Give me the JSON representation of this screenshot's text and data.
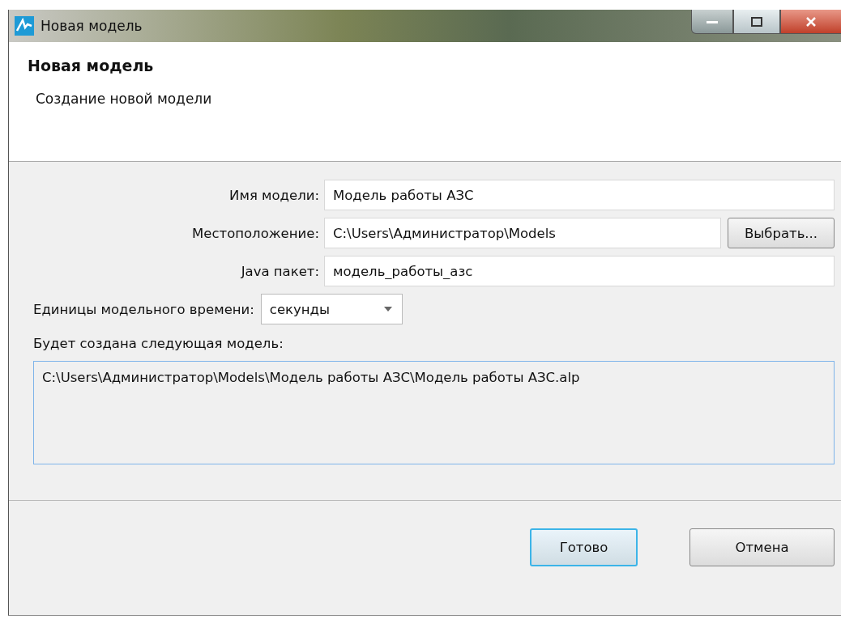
{
  "window": {
    "title": "Новая модель"
  },
  "header": {
    "title": "Новая модель",
    "subtitle": "Создание новой модели"
  },
  "fields": [
    {
      "kind": "text",
      "label": "Имя модели:",
      "value": "Модель работы АЗС"
    },
    {
      "kind": "browse",
      "label": "Местоположение:",
      "value": "C:\\Users\\Администратор\\Models",
      "button": "Выбрать..."
    },
    {
      "kind": "text",
      "label": "Java пакет:",
      "value": "модель_работы_азс"
    }
  ],
  "units": {
    "label": "Единицы модельного времени:",
    "value": "секунды"
  },
  "result": {
    "label": "Будет создана следующая модель:",
    "text": "C:\\Users\\Администратор\\Models\\Модель работы АЗС\\Модель работы АЗС.alp"
  },
  "buttons": [
    {
      "label": "Готово",
      "default": true
    },
    {
      "label": "Отмена",
      "default": false
    }
  ]
}
